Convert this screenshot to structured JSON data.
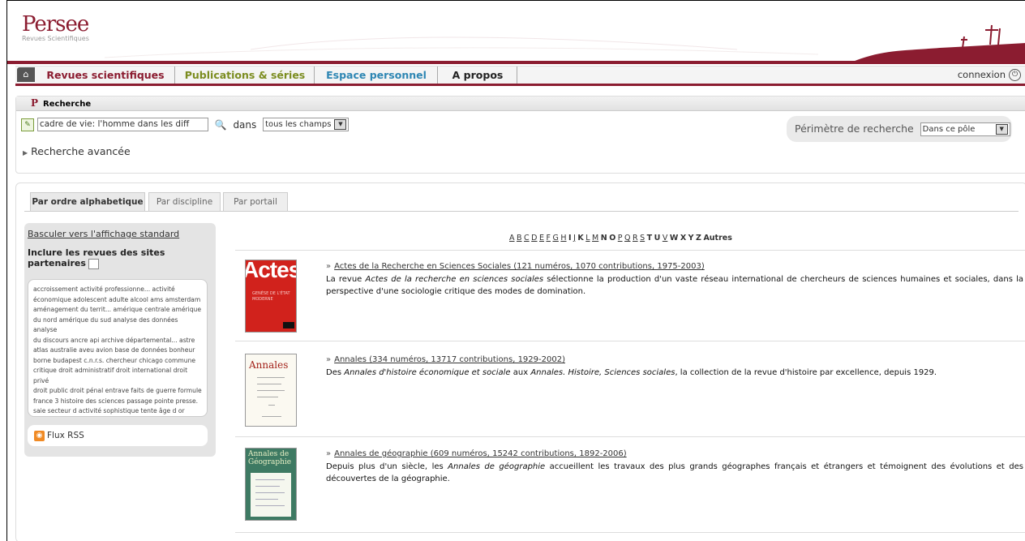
{
  "header": {
    "logo_word": "Persee",
    "logo_sub": "Revues Scientifiques",
    "colors": {
      "brand": "#8b1c30",
      "green": "#7b8c1f",
      "blue": "#2e86b3"
    }
  },
  "nav": {
    "home_icon": "home-icon",
    "items": [
      "Revues scientifiques",
      "Publications & séries",
      "Espace personnel",
      "A propos"
    ],
    "connexion": "connexion"
  },
  "search": {
    "section_title": "Recherche",
    "query_value": "cadre de vie: l'homme dans les diff",
    "dans_label": "dans",
    "field_select": "tous les champs",
    "advanced_link": "Recherche avancée",
    "perimetre_label": "Périmètre de recherche",
    "perimetre_select": "Dans ce pôle"
  },
  "tabs": [
    "Par ordre alphabetique",
    "Par discipline",
    "Par portail"
  ],
  "sidebar": {
    "switch_link": "Basculer vers l'affichage standard",
    "include_label": "Inclure les revues des sites partenaires",
    "tag_lines": [
      "accroissement activité professionne... activité",
      "économique adolescent adulte alcool ams amsterdam",
      "aménagement du territ... amérique centrale amérique",
      "du nord amérique du sud analyse des données analyse",
      "du discours ancre api archive départemental... astre",
      "atlas australie aveu avion base de données bonheur",
      "borne budapest c.n.r.s. chercheur chicago commune",
      "critique droit administratif droit international droit privé",
      "droit public droit pénal entrave faits de guerre formule",
      "france 3 histoire des sciences passage pointe presse.",
      "saie secteur d activité sophistique tente âge d or"
    ],
    "rss_label": "Flux RSS"
  },
  "letters": [
    {
      "t": "A",
      "u": true
    },
    {
      "t": "B",
      "u": true
    },
    {
      "t": "C",
      "u": true
    },
    {
      "t": "D",
      "u": true
    },
    {
      "t": "E",
      "u": true
    },
    {
      "t": "F",
      "u": true
    },
    {
      "t": "G",
      "u": true
    },
    {
      "t": "H",
      "u": true
    },
    {
      "t": "I",
      "u": false
    },
    {
      "t": "J",
      "u": true
    },
    {
      "t": "K",
      "u": false
    },
    {
      "t": "L",
      "u": true
    },
    {
      "t": "M",
      "u": true
    },
    {
      "t": "N",
      "u": false
    },
    {
      "t": "O",
      "u": false
    },
    {
      "t": "P",
      "u": true
    },
    {
      "t": "Q",
      "u": true
    },
    {
      "t": "R",
      "u": true
    },
    {
      "t": "S",
      "u": true
    },
    {
      "t": "T",
      "u": false
    },
    {
      "t": "U",
      "u": false
    },
    {
      "t": "V",
      "u": true
    },
    {
      "t": "W",
      "u": false
    },
    {
      "t": "X",
      "u": false
    },
    {
      "t": "Y",
      "u": false
    },
    {
      "t": "Z",
      "u": false
    },
    {
      "t": "Autres",
      "u": false
    }
  ],
  "journals": [
    {
      "title": "Actes de la Recherche en Sciences Sociales (121 numéros, 1070 contributions, 1975-2003)",
      "desc_html": "La revue <i>Actes de la recherche en sciences sociales</i> sélectionne la production d'un vaste réseau international de chercheurs de sciences humaines et sociales, dans la perspective d'une sociologie critique des modes de domination.",
      "cover_text": "Actes",
      "cover_sub": "GENÈSE DE L'ÉTAT MODERNE"
    },
    {
      "title": "Annales (334 numéros, 13717 contributions, 1929-2002)",
      "desc_html": "Des <i>Annales d'histoire économique et sociale</i> aux <i>Annales. Histoire, Sciences sociales</i>, la collection de la revue d'histoire par excellence, depuis 1929.",
      "cover_text": "Annales"
    },
    {
      "title": "Annales de géographie (609 numéros, 15242 contributions, 1892-2006)",
      "desc_html": "Depuis plus d'un siècle, les <i>Annales de géographie</i> accueillent les travaux des plus grands géographes français et étrangers et témoignent des évolutions et des découvertes de la géographie.",
      "cover_text": "Annales de Géographie"
    }
  ]
}
